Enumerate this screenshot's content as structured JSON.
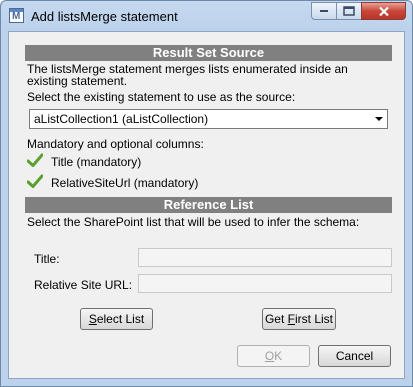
{
  "window": {
    "title": "Add listsMerge statement",
    "icon": "app-icon"
  },
  "source_section": {
    "header": "Result Set Source",
    "description": "The listsMerge statement merges lists enumerated inside an existing statement.",
    "select_prompt": "Select the existing statement to use as the source:",
    "selected_statement": "aListCollection1 (aListCollection)",
    "columns_label": "Mandatory and optional columns:",
    "columns": [
      {
        "name": "Title (mandatory)",
        "icon": "check-icon"
      },
      {
        "name": "RelativeSiteUrl (mandatory)",
        "icon": "check-icon"
      }
    ]
  },
  "reference_section": {
    "header": "Reference List",
    "prompt": "Select the SharePoint list that will be used to infer the schema:",
    "title_label": "Title:",
    "title_value": "",
    "url_label": "Relative Site URL:",
    "url_value": "",
    "select_list_button": {
      "mnemonic": "S",
      "rest": "elect List"
    },
    "get_first_list_button": {
      "pre": "Get ",
      "mnemonic": "F",
      "rest": "irst List"
    }
  },
  "footer": {
    "ok_button": {
      "mnemonic": "O",
      "rest": "K"
    },
    "cancel_button": "Cancel"
  },
  "colors": {
    "section_header_bg": "#808080",
    "check": "#5aa02c"
  }
}
